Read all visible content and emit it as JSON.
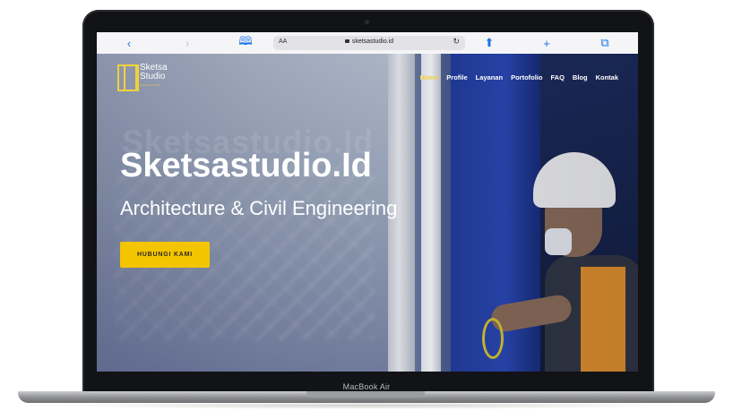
{
  "device": {
    "label": "MacBook Air"
  },
  "browser": {
    "text_size": "AA",
    "url": "sketsastudio.id",
    "icons": {
      "back": "chevron-left-icon",
      "forward": "chevron-right-icon",
      "bookmarks": "book-icon",
      "lock": "lock-icon",
      "reload": "reload-icon",
      "share": "share-icon",
      "new_tab": "plus-icon",
      "tabs": "tabs-icon"
    }
  },
  "site": {
    "logo": {
      "line1": "Sketsa",
      "line2": "Studio",
      "tagline": "Arsitek & Sipil"
    },
    "nav": [
      "Home",
      "Profile",
      "Layanan",
      "Portofolio",
      "FAQ",
      "Blog",
      "Kontak"
    ],
    "active_nav": "Home",
    "hero": {
      "ghost_text": "Sketsastudio.Id",
      "title": "Sketsastudio.Id",
      "subtitle": "Architecture & Civil Engineering",
      "cta_label": "HUBUNGI KAMI"
    },
    "colors": {
      "accent": "#f2c500",
      "text": "#ffffff"
    }
  }
}
